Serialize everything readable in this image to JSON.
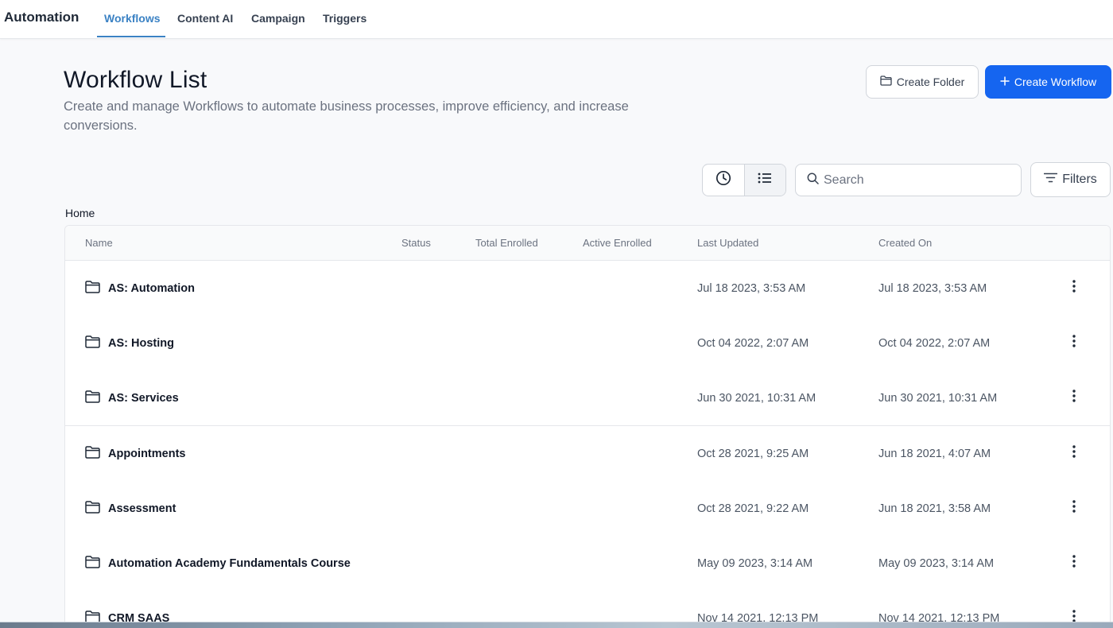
{
  "nav": {
    "brand": "Automation",
    "tabs": [
      {
        "label": "Workflows",
        "active": true
      },
      {
        "label": "Content AI",
        "active": false
      },
      {
        "label": "Campaign",
        "active": false
      },
      {
        "label": "Triggers",
        "active": false
      }
    ]
  },
  "header": {
    "title": "Workflow List",
    "description": "Create and manage Workflows to automate business processes, improve efficiency, and increase conversions.",
    "create_folder_label": "Create Folder",
    "create_workflow_label": "Create Workflow"
  },
  "toolbar": {
    "search_placeholder": "Search",
    "filters_label": "Filters",
    "view_modes": [
      "clock-icon",
      "list-icon"
    ],
    "selected_view": "list-icon"
  },
  "breadcrumb": "Home",
  "table": {
    "columns": [
      "Name",
      "Status",
      "Total Enrolled",
      "Active Enrolled",
      "Last Updated",
      "Created On"
    ],
    "rows": [
      {
        "name": "AS: Automation",
        "last_updated": "Jul 18 2023, 3:53 AM",
        "created_on": "Jul 18 2023, 3:53 AM"
      },
      {
        "name": "AS: Hosting",
        "last_updated": "Oct 04 2022, 2:07 AM",
        "created_on": "Oct 04 2022, 2:07 AM"
      },
      {
        "name": "AS: Services",
        "last_updated": "Jun 30 2021, 10:31 AM",
        "created_on": "Jun 30 2021, 10:31 AM"
      },
      {
        "name": "Appointments",
        "last_updated": "Oct 28 2021, 9:25 AM",
        "created_on": "Jun 18 2021, 4:07 AM"
      },
      {
        "name": "Assessment",
        "last_updated": "Oct 28 2021, 9:22 AM",
        "created_on": "Jun 18 2021, 3:58 AM"
      },
      {
        "name": "Automation Academy Fundamentals Course",
        "last_updated": "May 09 2023, 3:14 AM",
        "created_on": "May 09 2023, 3:14 AM"
      },
      {
        "name": "CRM SAAS",
        "last_updated": "Nov 14 2021, 12:13 PM",
        "created_on": "Nov 14 2021, 12:13 PM"
      }
    ]
  },
  "colors": {
    "accent": "#3b82c4",
    "primary_button": "#1565f0"
  }
}
